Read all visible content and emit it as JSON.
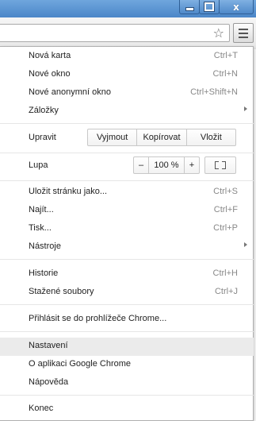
{
  "window": {
    "minimize_icon": "minimize-icon",
    "maximize_icon": "restore-icon",
    "close_label": "x"
  },
  "toolbar": {
    "bookmark_star": "☆",
    "menu_icon": "hamburger-icon"
  },
  "menu": {
    "new_tab": {
      "label": "Nová karta",
      "accel": "Ctrl+T"
    },
    "new_window": {
      "label": "Nové okno",
      "accel": "Ctrl+N"
    },
    "incognito": {
      "label": "Nové anonymní okno",
      "accel": "Ctrl+Shift+N"
    },
    "bookmarks": {
      "label": "Záložky"
    },
    "edit": {
      "label": "Upravit",
      "cut": "Vyjmout",
      "copy": "Kopírovat",
      "paste": "Vložit"
    },
    "zoom": {
      "label": "Lupa",
      "minus": "–",
      "value": "100 %",
      "plus": "+"
    },
    "save_page": {
      "label": "Uložit stránku jako...",
      "accel": "Ctrl+S"
    },
    "find": {
      "label": "Najít...",
      "accel": "Ctrl+F"
    },
    "print": {
      "label": "Tisk...",
      "accel": "Ctrl+P"
    },
    "tools": {
      "label": "Nástroje"
    },
    "history": {
      "label": "Historie",
      "accel": "Ctrl+H"
    },
    "downloads": {
      "label": "Stažené soubory",
      "accel": "Ctrl+J"
    },
    "sign_in": {
      "label": "Přihlásit se do prohlížeče Chrome..."
    },
    "settings": {
      "label": "Nastavení"
    },
    "about": {
      "label": "O aplikaci Google Chrome"
    },
    "help": {
      "label": "Nápověda"
    },
    "exit": {
      "label": "Konec"
    }
  }
}
